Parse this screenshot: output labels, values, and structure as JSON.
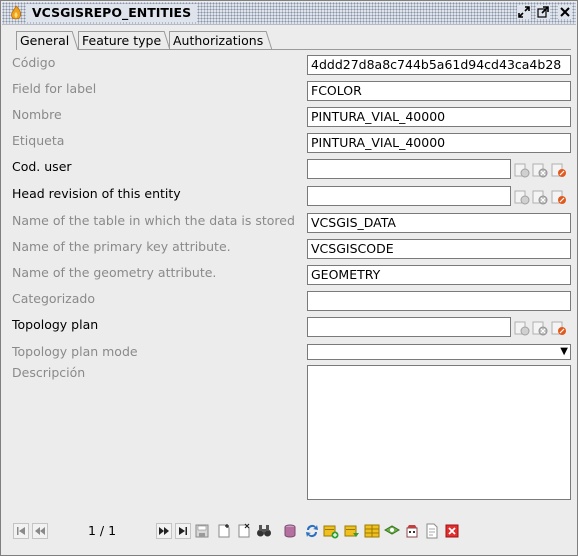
{
  "window": {
    "title": "VCSGISREPO_ENTITIES",
    "icon": "app-flame-icon",
    "buttons": [
      "restore-icon",
      "maximize-icon",
      "close-icon"
    ]
  },
  "tabs": [
    {
      "label": "General",
      "active": true
    },
    {
      "label": "Feature type",
      "active": false
    },
    {
      "label": "Authorizations",
      "active": false
    }
  ],
  "fields": {
    "codigo": {
      "label": "Código",
      "value": "4ddd27d8a8c744b5a61d94cd43ca4b28",
      "enabled": false
    },
    "field_for_label": {
      "label": "Field for label",
      "value": "FCOLOR",
      "enabled": false
    },
    "nombre": {
      "label": "Nombre",
      "value": "PINTURA_VIAL_40000",
      "enabled": false
    },
    "etiqueta": {
      "label": "Etiqueta",
      "value": "PINTURA_VIAL_40000",
      "enabled": false
    },
    "cod_user": {
      "label": "Cod. user",
      "value": "",
      "enabled": true
    },
    "head_revision": {
      "label": "Head revision of this entity",
      "value": "",
      "enabled": true
    },
    "table_name": {
      "label": "Name of the table in which the data is stored",
      "value": "VCSGIS_DATA",
      "enabled": false
    },
    "pk_attribute": {
      "label": "Name of the primary key attribute.",
      "value": "VCSGISCODE",
      "enabled": false
    },
    "geometry_attribute": {
      "label": "Name of the geometry attribute.",
      "value": "GEOMETRY",
      "enabled": false
    },
    "categorizado": {
      "label": "Categorizado",
      "value": "",
      "enabled": false
    },
    "topology_plan": {
      "label": "Topology plan",
      "value": "",
      "enabled": true
    },
    "topology_plan_mode": {
      "label": "Topology plan mode",
      "value": "",
      "enabled": false
    },
    "descripcion": {
      "label": "Descripción",
      "value": "",
      "enabled": false
    }
  },
  "navigation": {
    "position": "1 / 1"
  },
  "colors": {
    "titlebar_bg": "#dfe4ec",
    "window_bg": "#ececec",
    "disabled_label": "#8a8a8a"
  }
}
